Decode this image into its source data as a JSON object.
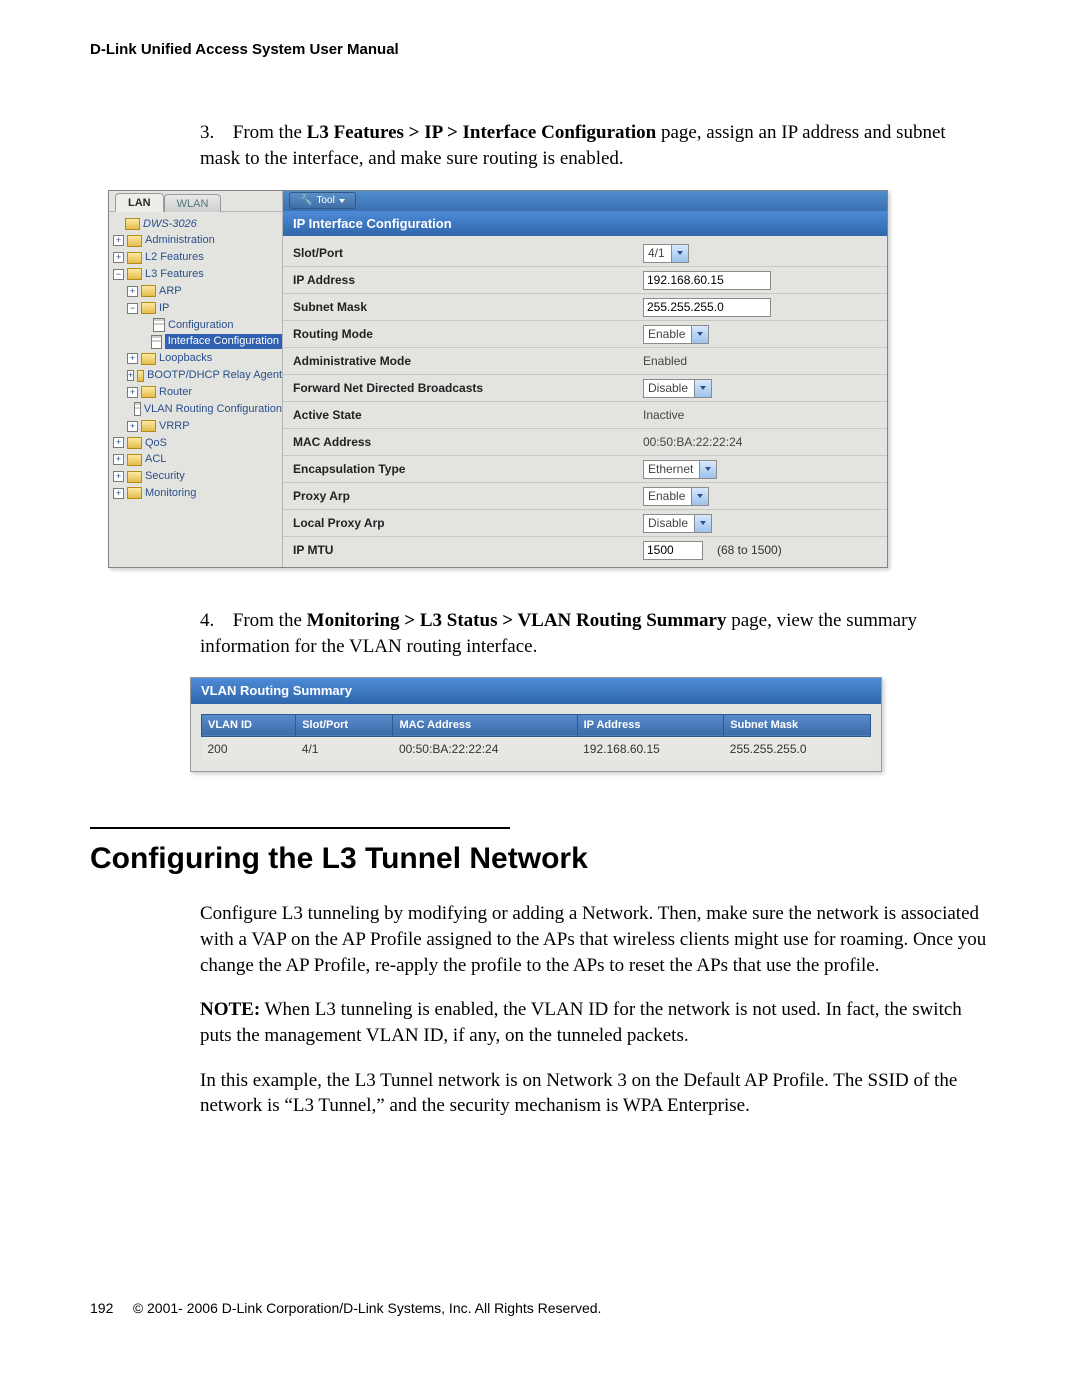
{
  "header": "D-Link Unified Access System User Manual",
  "step3": {
    "num": "3.",
    "before": "From the ",
    "bold": "L3 Features > IP > Interface Configuration",
    "after": " page, assign an IP address and subnet mask to the interface, and make sure routing is enabled."
  },
  "shot1": {
    "tool_label": "Tool",
    "tabs": {
      "lan": "LAN",
      "wlan": "WLAN"
    },
    "device": "DWS-3026",
    "tree": {
      "admin": "Administration",
      "l2": "L2 Features",
      "l3": "L3 Features",
      "arp": "ARP",
      "ip": "IP",
      "config": "Configuration",
      "ifcfg": "Interface Configuration",
      "loopbacks": "Loopbacks",
      "bootp": "BOOTP/DHCP Relay Agent",
      "router": "Router",
      "vlanrc": "VLAN Routing Configuration",
      "vrrp": "VRRP",
      "qos": "QoS",
      "acl": "ACL",
      "security": "Security",
      "monitoring": "Monitoring"
    },
    "panel_title": "IP Interface Configuration",
    "rows": {
      "slot_port": {
        "label": "Slot/Port",
        "value": "4/1"
      },
      "ip_address": {
        "label": "IP Address",
        "value": "192.168.60.15"
      },
      "subnet_mask": {
        "label": "Subnet Mask",
        "value": "255.255.255.0"
      },
      "routing_mode": {
        "label": "Routing Mode",
        "value": "Enable"
      },
      "admin_mode": {
        "label": "Administrative Mode",
        "value": "Enabled"
      },
      "fwd_ndb": {
        "label": "Forward Net Directed Broadcasts",
        "value": "Disable"
      },
      "active_state": {
        "label": "Active State",
        "value": "Inactive"
      },
      "mac": {
        "label": "MAC Address",
        "value": "00:50:BA:22:22:24"
      },
      "encap": {
        "label": "Encapsulation Type",
        "value": "Ethernet"
      },
      "proxy_arp": {
        "label": "Proxy Arp",
        "value": "Enable"
      },
      "local_proxy_arp": {
        "label": "Local Proxy Arp",
        "value": "Disable"
      },
      "ip_mtu": {
        "label": "IP MTU",
        "value": "1500",
        "hint": "(68 to 1500)"
      }
    }
  },
  "step4": {
    "num": "4.",
    "before": "From the ",
    "bold": "Monitoring > L3 Status > VLAN Routing Summary",
    "after": " page, view the summary information for the VLAN routing interface."
  },
  "shot2": {
    "title": "VLAN Routing Summary",
    "headers": [
      "VLAN ID",
      "Slot/Port",
      "MAC Address",
      "IP Address",
      "Subnet Mask"
    ],
    "row": [
      "200",
      "4/1",
      "00:50:BA:22:22:24",
      "192.168.60.15",
      "255.255.255.0"
    ]
  },
  "section_title": "Configuring the L3 Tunnel Network",
  "para1": "Configure L3 tunneling by modifying or adding a Network. Then, make sure the network is associated with a VAP on the AP Profile assigned to the APs that wireless clients might use for roaming. Once you change the AP Profile, re-apply the profile to the APs to reset the APs that use the profile.",
  "note_label": "NOTE:",
  "note_text": " When L3 tunneling is enabled, the VLAN ID for the network is not used. In fact, the switch puts the management VLAN ID, if any, on the tunneled packets.",
  "para2": "In this example, the L3 Tunnel network is on Network 3 on the Default AP Profile. The SSID of the network is “L3 Tunnel,” and the security mechanism is WPA Enterprise.",
  "footer": {
    "page": "192",
    "copy": "© 2001- 2006 D-Link Corporation/D-Link Systems, Inc. All Rights Reserved."
  }
}
